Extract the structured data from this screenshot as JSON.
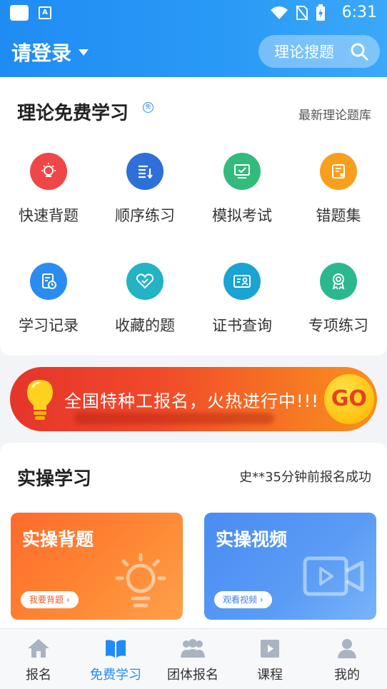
{
  "status": {
    "time": "6:31"
  },
  "header": {
    "login_label": "请登录",
    "search_label": "理论搜题"
  },
  "theory": {
    "title": "理论免费学习",
    "badge": "免",
    "more": "最新理论题库",
    "items": [
      {
        "label": "快速背题",
        "icon": "bulb-icon",
        "color": "#ef4748"
      },
      {
        "label": "顺序练习",
        "icon": "list-order-icon",
        "color": "#2f6fd8"
      },
      {
        "label": "模拟考试",
        "icon": "monitor-check-icon",
        "color": "#33bb7d"
      },
      {
        "label": "错题集",
        "icon": "wrong-notebook-icon",
        "color": "#f8a01e"
      },
      {
        "label": "学习记录",
        "icon": "record-clock-icon",
        "color": "#2b8cf0"
      },
      {
        "label": "收藏的题",
        "icon": "heart-check-icon",
        "color": "#22b3c4"
      },
      {
        "label": "证书查询",
        "icon": "certificate-id-icon",
        "color": "#1aa4d4"
      },
      {
        "label": "专项练习",
        "icon": "award-medal-icon",
        "color": "#2cb88e"
      }
    ]
  },
  "banner": {
    "text": "全国特种工报名，火热进行中!!!",
    "go": "GO"
  },
  "practice": {
    "title": "实操学习",
    "notice": "史**35分钟前报名成功",
    "tiles": [
      {
        "title": "实操背题",
        "button": "我要背题",
        "button_color": "#f05a2a"
      },
      {
        "title": "实操视频",
        "button": "观看视频",
        "button_color": "#3b7fe8"
      }
    ]
  },
  "tabs": [
    {
      "label": "报名",
      "icon": "home-icon"
    },
    {
      "label": "免费学习",
      "icon": "book-icon",
      "active": true
    },
    {
      "label": "团体报名",
      "icon": "group-icon"
    },
    {
      "label": "课程",
      "icon": "play-icon"
    },
    {
      "label": "我的",
      "icon": "user-icon"
    }
  ],
  "colors": {
    "primary": "#1f8cf3",
    "banner_start": "#e5352b",
    "banner_end": "#f88f1e"
  }
}
